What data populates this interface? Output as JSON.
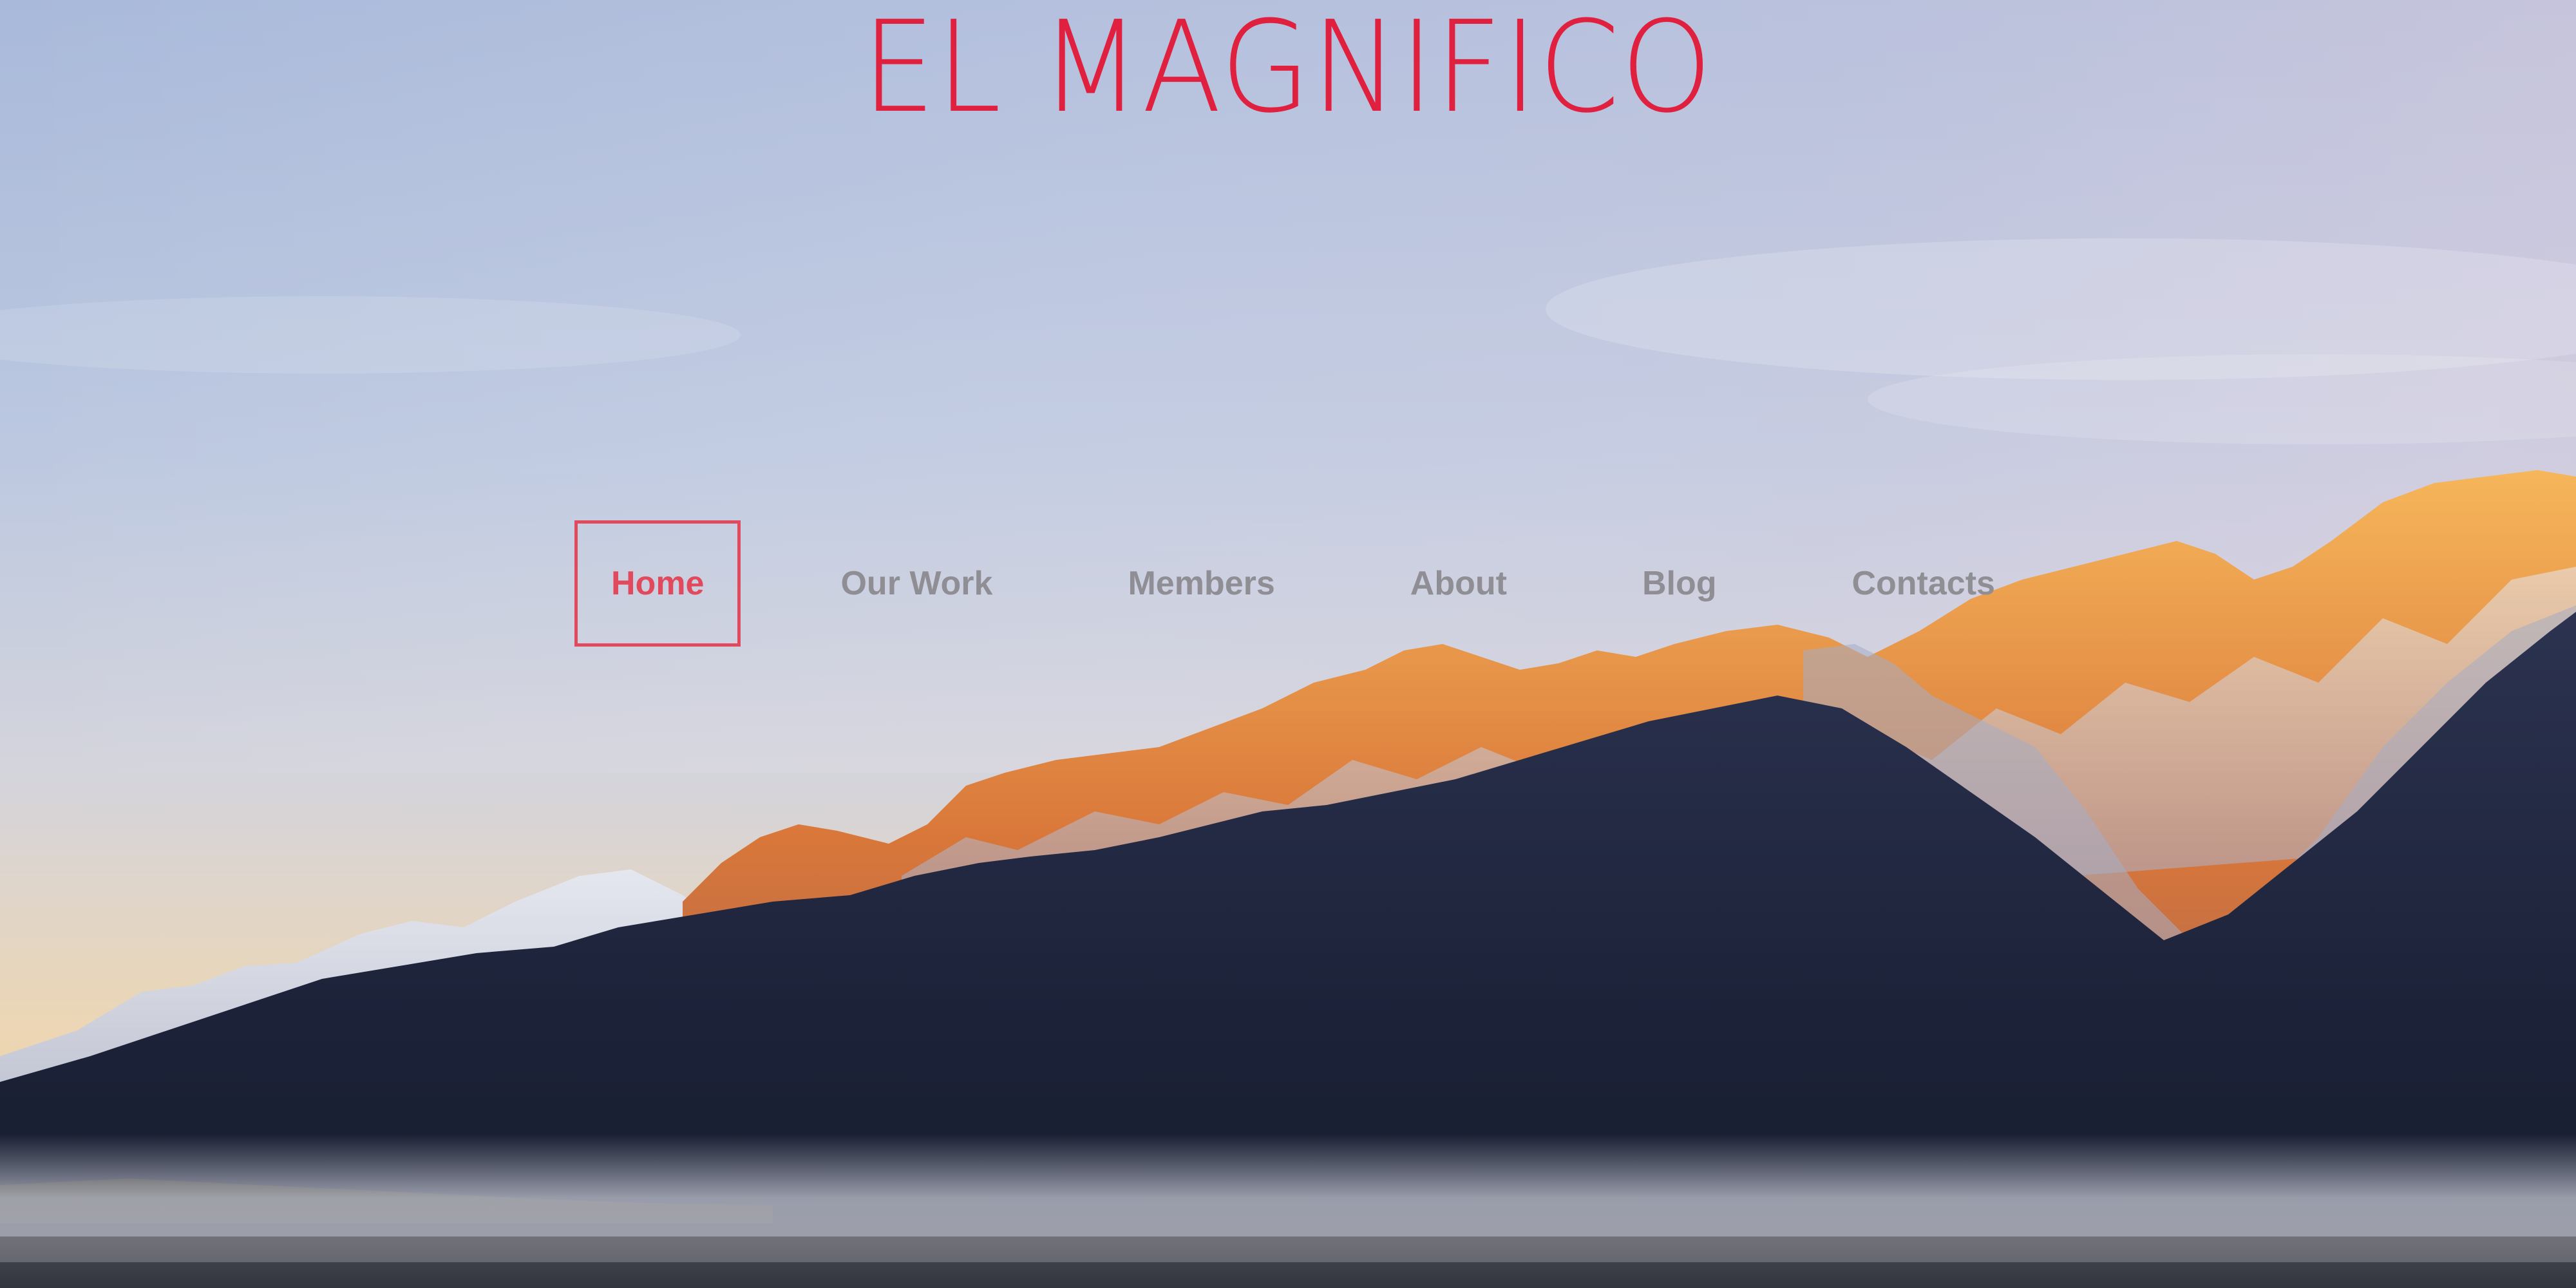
{
  "site": {
    "title": "EL MAGNIFICO"
  },
  "nav": {
    "items": [
      {
        "label": "Home",
        "active": true
      },
      {
        "label": "Our Work",
        "active": false
      },
      {
        "label": "Members",
        "active": false
      },
      {
        "label": "About",
        "active": false
      },
      {
        "label": "Blog",
        "active": false
      },
      {
        "label": "Contacts",
        "active": false
      }
    ]
  },
  "colors": {
    "brand": "#e0203f",
    "nav_active": "#e04a5c",
    "nav_text": "#8e8e94"
  },
  "background": {
    "image_icon": "mountain-landscape-photo"
  }
}
